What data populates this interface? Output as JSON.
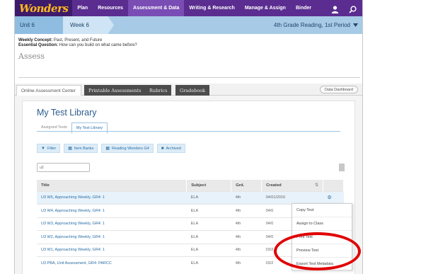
{
  "nav": {
    "logo": "Wonders",
    "items": [
      "Plan",
      "Resources",
      "Assessment & Data",
      "Writing & Research",
      "Manage & Assign",
      "Binder"
    ],
    "active_index": 2,
    "icons": [
      "user-icon",
      "search-icon"
    ]
  },
  "unitbar": {
    "unit": "Unit 6",
    "week": "Week 6",
    "period": "4th Grade Reading, 1st Period"
  },
  "concept": {
    "weekly_label": "Weekly Concept:",
    "weekly_value": "Past, Present, and Future",
    "question_label": "Essential Question:",
    "question_value": "How can you build on what came before?",
    "assess": "Assess"
  },
  "tabs": {
    "items": [
      "Online Assessment Center",
      "Printable Assessments",
      "Rubrics",
      "Gradebook"
    ],
    "dashboard": "Data Dashboard"
  },
  "library": {
    "title": "My Test Library",
    "subtabs": [
      "Assigned Tests",
      "My Test Library"
    ],
    "filters": [
      "Filter",
      "Item Banks",
      "Reading Wonders G4",
      "Archived"
    ],
    "search_value": "u3",
    "columns": [
      "Title",
      "Subject",
      "Grd.",
      "Created"
    ],
    "rows": [
      {
        "title": "U3 W5, Approaching Weekly, GR4: 1",
        "subject": "ELA",
        "grade": "4th",
        "created": "04/01/2016"
      },
      {
        "title": "U3 W4, Approaching Weekly, GR4: 1",
        "subject": "ELA",
        "grade": "4th",
        "created": "04/0"
      },
      {
        "title": "U3 W3, Approaching Weekly, GR4: 1",
        "subject": "ELA",
        "grade": "4th",
        "created": "04/0"
      },
      {
        "title": "U3 W2, Approaching Weekly, GR4: 1",
        "subject": "ELA",
        "grade": "4th",
        "created": "04/0"
      },
      {
        "title": "U3 W1, Approaching Weekly, GR4: 1",
        "subject": "ELA",
        "grade": "4th",
        "created": "03/2"
      },
      {
        "title": "U3 PBA, Unit Assessment, GR4: PARCC",
        "subject": "ELA",
        "grade": "4th",
        "created": "03/2"
      }
    ]
  },
  "menu": {
    "items": [
      "Copy Test",
      "Assign to Class",
      "Print Test",
      "Preview Test",
      "Export Test Metadata"
    ]
  },
  "colors": {
    "nav": "#5b2d90",
    "unitbar": "#a7cbe6",
    "link": "#2a6ea6",
    "highlight": "#e00000"
  }
}
